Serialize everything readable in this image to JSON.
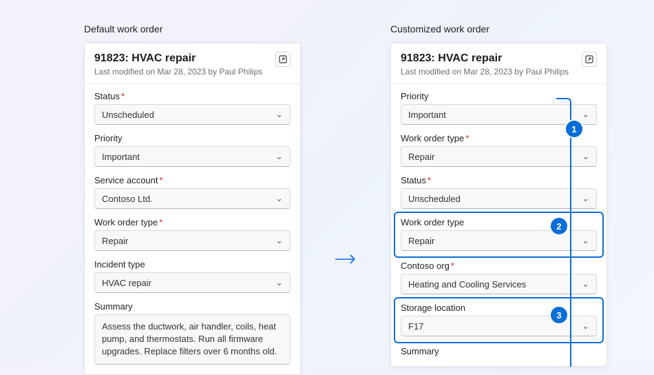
{
  "left": {
    "heading": "Default work order",
    "title": "91823: HVAC repair",
    "subtitle": "Last modified on Mar 28, 2023 by Paul Philips",
    "fields": {
      "status": {
        "label": "Status",
        "required": true,
        "value": "Unscheduled"
      },
      "priority": {
        "label": "Priority",
        "required": false,
        "value": "Important"
      },
      "service_account": {
        "label": "Service account",
        "required": true,
        "value": "Contoso Ltd."
      },
      "work_order_type": {
        "label": "Work order type",
        "required": true,
        "value": "Repair"
      },
      "incident_type": {
        "label": "Incident type",
        "required": false,
        "value": "HVAC repair"
      },
      "summary": {
        "label": "Summary",
        "value": "Assess the ductwork, air handler, coils, heat pump, and thermostats. Run all firmware upgrades. Replace filters over 6 months old."
      }
    }
  },
  "right": {
    "heading": "Customized work order",
    "title": "91823: HVAC repair",
    "subtitle": "Last modified on Mar 28, 2023 by Paul Philips",
    "fields": {
      "priority": {
        "label": "Priority",
        "required": false,
        "value": "Important"
      },
      "work_order_type_req": {
        "label": "Work order type",
        "required": true,
        "value": "Repair"
      },
      "status": {
        "label": "Status",
        "required": true,
        "value": "Unscheduled"
      },
      "work_order_type": {
        "label": "Work order type",
        "required": false,
        "value": "Repair"
      },
      "contoso_org": {
        "label": "Contoso org",
        "required": true,
        "value": "Heating and Cooling Services"
      },
      "storage_location": {
        "label": "Storage location",
        "required": false,
        "value": "F17"
      },
      "summary": {
        "label": "Summary"
      }
    }
  },
  "callouts": {
    "one": "1",
    "two": "2",
    "three": "3"
  }
}
